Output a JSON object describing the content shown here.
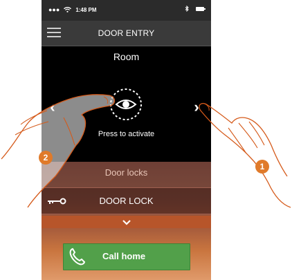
{
  "status_bar": {
    "time": "1:48 PM"
  },
  "header": {
    "title": "DOOR ENTRY"
  },
  "room": {
    "title": "Room",
    "press_label": "Press to activate"
  },
  "door_locks": {
    "header": "Door locks",
    "item_label": "DOOR LOCK"
  },
  "call_home": {
    "label": "Call home"
  },
  "annotations": {
    "step_1": "1",
    "step_2": "2"
  },
  "colors": {
    "call_button": "#52a04a",
    "step_badge": "#e07a2a",
    "nav_bar": "#3a3a3a"
  }
}
